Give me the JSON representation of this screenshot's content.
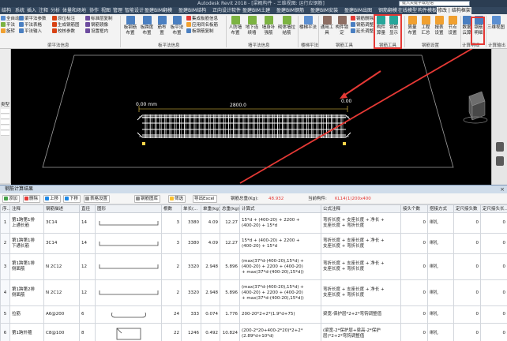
{
  "app": {
    "title": "Autodesk Revit 2018 - [梁概构件 - 三维视图: 运行应钢筋]",
    "search_placeholder": "键入关键字或短语"
  },
  "tabs": [
    {
      "label": "结构"
    },
    {
      "label": "系统"
    },
    {
      "label": "插入"
    },
    {
      "label": "注释"
    },
    {
      "label": "分析"
    },
    {
      "label": "体量和场地"
    },
    {
      "label": "协作"
    },
    {
      "label": "视图"
    },
    {
      "label": "管理"
    },
    {
      "label": "智能设计"
    },
    {
      "label": "盈建BIM翻模"
    },
    {
      "label": "盈建BIM结构"
    },
    {
      "label": "正向设计软件"
    },
    {
      "label": "盈建BIM土建"
    },
    {
      "label": "盈建BIM钢筋"
    },
    {
      "label": "盈建BIM安装"
    },
    {
      "label": "盈建BIM出图"
    },
    {
      "label": "钢筋翻模"
    },
    {
      "label": "在线模型"
    },
    {
      "label": "构件模板"
    },
    {
      "label": "修改 | 结构框架"
    }
  ],
  "ribbon": {
    "col1": [
      "全自动",
      "平法",
      "旋转"
    ],
    "col2": [
      "梁平法参数",
      "平法表格",
      "平法输入"
    ],
    "col3": [
      "原位标注",
      "生成钢筋图",
      "校核参数"
    ],
    "col4": [
      "标准层复制",
      "钢筋镜像",
      "设置框内"
    ],
    "group1": "梁平法信息",
    "group2_big": [
      "板钢筋布置",
      "板跨度布置",
      "筋布置",
      "板平法布置"
    ],
    "col5": [
      "集成板筋信息",
      "应用同名板筋",
      "板钢筋复制"
    ],
    "group2": "板平法信息",
    "group3_big": [
      "人防墙布置",
      "地下连续墙",
      "墙身补强筋",
      "砌体墙拉结筋"
    ],
    "group3": "墙平法信息",
    "group4_big": [
      "楼梯平法"
    ],
    "group4": "楼梯平法",
    "group5_big": [
      "通用工具",
      "构件锁定"
    ],
    "col6": [
      "钢筋删除",
      "钢筋调整",
      "延长调整"
    ],
    "group5": "钢筋工具",
    "group6_big": [
      "构件算量",
      "钢筋显示"
    ],
    "group6": "钢筋工具",
    "group7_big": [
      "算量布置",
      "工程汇总",
      "报表设置",
      "节点设置"
    ],
    "group7": "钢筋设置",
    "group8_big": [
      "数据云算",
      "钢筋明细"
    ],
    "group8": "计算明细",
    "group9_big": [
      "三维视图"
    ],
    "group9": "计算输出"
  },
  "left_panel": {
    "label": "类型"
  },
  "viewport": {
    "left_dim": "0.00 mm",
    "span_dim": "2800.0",
    "right_dim": "0.00"
  },
  "dialog": {
    "title": "钢筋计算结果",
    "close_glyph": "×",
    "buttons": [
      "添加",
      "删除",
      "上移",
      "下移",
      "表格设置",
      "钢筋图库",
      "筛选",
      "导出Excel"
    ],
    "total_weight_label": "钢筋总重(Kg):",
    "total_weight_value": "48.932",
    "current_member_label": "当前构件:",
    "current_member_value": "KL14(1)200x400"
  },
  "table": {
    "headers": [
      "序...",
      "注释",
      "钢筋描述",
      "直径",
      "图形",
      "根数",
      "单长(...",
      "单重(kg)",
      "总重(kg)",
      "计算式",
      "公式注释",
      "接头个数",
      "搭接方式",
      "定尺接头数",
      "定尺接头长..."
    ],
    "rows": [
      {
        "no": "1",
        "note": "第1跨第1排\n上通长筋",
        "desc": "3C14",
        "dia": "14",
        "shape": "hook-both",
        "count": "3",
        "length": "3380",
        "unit_w": "4.09",
        "total_w": "12.27",
        "formula": "15*d + (400-20) + 2200 +\n(400-20) + 15*d",
        "comment": "弯折长度 + 支座长度 + 净长 +\n支座长度 + 弯折长度",
        "joints": "0",
        "lap": "绑扎",
        "fixed_joints": "0",
        "fixed_len": "0"
      },
      {
        "no": "2",
        "note": "第1跨第1排\n下通长筋",
        "desc": "3C14",
        "dia": "14",
        "shape": "hook-both",
        "count": "3",
        "length": "3380",
        "unit_w": "4.09",
        "total_w": "12.27",
        "formula": "15*d + (400-20) + 2200 +\n(400-20) + 15*d",
        "comment": "弯折长度 + 支座长度 + 净长 +\n支座长度 + 弯折长度",
        "joints": "0",
        "lap": "绑扎",
        "fixed_joints": "0",
        "fixed_len": "0"
      },
      {
        "no": "3",
        "note": "第1跨第1排\n侧面筋",
        "desc": "N 2C12",
        "dia": "12",
        "shape": "hook-both",
        "count": "2",
        "length": "3320",
        "unit_w": "2.948",
        "total_w": "5.896",
        "formula": "(max(37*d-(400-20),15*d) +\n(400-20) + 2200 + (400-20)\n+ max(37*d-(400-20),15*d))",
        "comment": "弯折长度 + 支座长度 + 净长 +\n支座长度 + 弯折长度",
        "joints": "0",
        "lap": "绑扎",
        "fixed_joints": "0",
        "fixed_len": "0"
      },
      {
        "no": "4",
        "note": "第1跨第2排\n侧面筋",
        "desc": "N 2C12",
        "dia": "12",
        "shape": "hook-both",
        "count": "2",
        "length": "3320",
        "unit_w": "2.948",
        "total_w": "5.896",
        "formula": "(max(37*d-(400-20),15*d) +\n(400-20) + 2200 + (400-20)\n+ max(37*d-(400-20),15*d))",
        "comment": "弯折长度 + 支座长度 + 净长 +\n支座长度 + 弯折长度",
        "joints": "0",
        "lap": "绑扎",
        "fixed_joints": "0",
        "fixed_len": "0"
      },
      {
        "no": "5",
        "note": "拉筋",
        "desc": "A6@200",
        "dia": "6",
        "shape": "tie",
        "count": "24",
        "length": "333",
        "unit_w": "0.074",
        "total_w": "1.776",
        "formula": "200-20*2+2*(1.9*d+75)",
        "comment": "梁宽-保护层*2+2*弯钩调整值",
        "joints": "0",
        "lap": "绑扎",
        "fixed_joints": "0",
        "fixed_len": "0"
      },
      {
        "no": "6",
        "note": "第1跨外箍",
        "desc": "C8@100",
        "dia": "8",
        "shape": "stirrup",
        "count": "22",
        "length": "1246",
        "unit_w": "0.492",
        "total_w": "10.824",
        "formula": "(200-2*20+400-2*20)*2+2*\n(2.89*d+10*d)",
        "comment": "(梁宽-2*保护层+梁高-2*保护\n层)*2+2*弯钩调整值",
        "joints": "0",
        "lap": "绑扎",
        "fixed_joints": "0",
        "fixed_len": "0"
      }
    ]
  },
  "colors": {
    "accent": "#e53935",
    "title_bar": "#2b3d52",
    "dialog_header": "#cfdcea",
    "rebar": "#ffffff",
    "dim_text": "#ffd54a"
  }
}
